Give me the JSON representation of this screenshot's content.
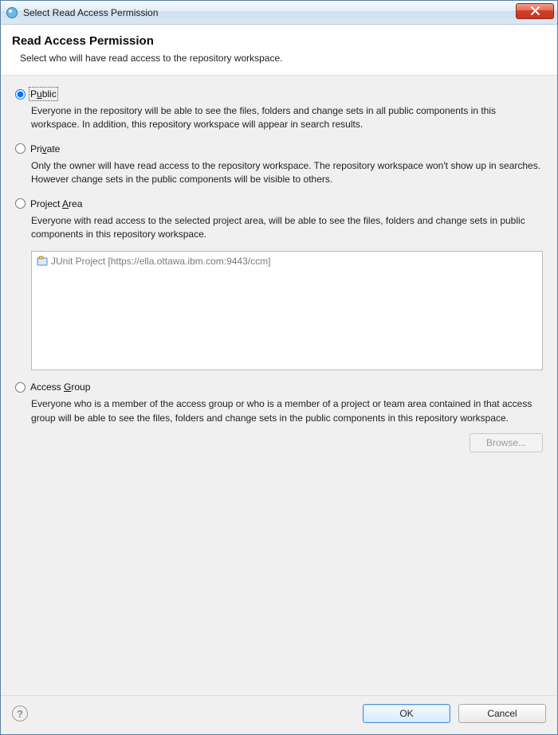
{
  "window": {
    "title": "Select Read Access Permission"
  },
  "banner": {
    "heading": "Read Access Permission",
    "subheading": "Select who will have read access to the repository workspace."
  },
  "options": {
    "public": {
      "label_pre": "P",
      "label_mn": "u",
      "label_post": "blic",
      "description": "Everyone in the repository will be able to see the files, folders and change sets in all public components in this workspace. In addition, this repository workspace will appear in search results.",
      "selected": true
    },
    "private": {
      "label_pre": "Pri",
      "label_mn": "v",
      "label_post": "ate",
      "description": "Only the owner will have read access to the repository workspace. The repository workspace won't show up in searches. However change sets in the public components will be visible to others.",
      "selected": false
    },
    "project_area": {
      "label_pre": "Project ",
      "label_mn": "A",
      "label_post": "rea",
      "description": "Everyone with read access to the selected project area, will be able to see the files, folders and change sets in public components in this repository workspace.",
      "selected": false,
      "items": [
        {
          "text": "JUnit Project [https://ella.ottawa.ibm.com:9443/ccm]"
        }
      ]
    },
    "access_group": {
      "label_pre": "Access ",
      "label_mn": "G",
      "label_post": "roup",
      "description": "Everyone who is a member of the access group or who is a member of a project or team area contained in that access group will be able to see the files, folders and change sets in the public components in this repository workspace.",
      "selected": false,
      "browse_label": "Browse...",
      "browse_enabled": false
    }
  },
  "buttons": {
    "ok": "OK",
    "cancel": "Cancel"
  }
}
